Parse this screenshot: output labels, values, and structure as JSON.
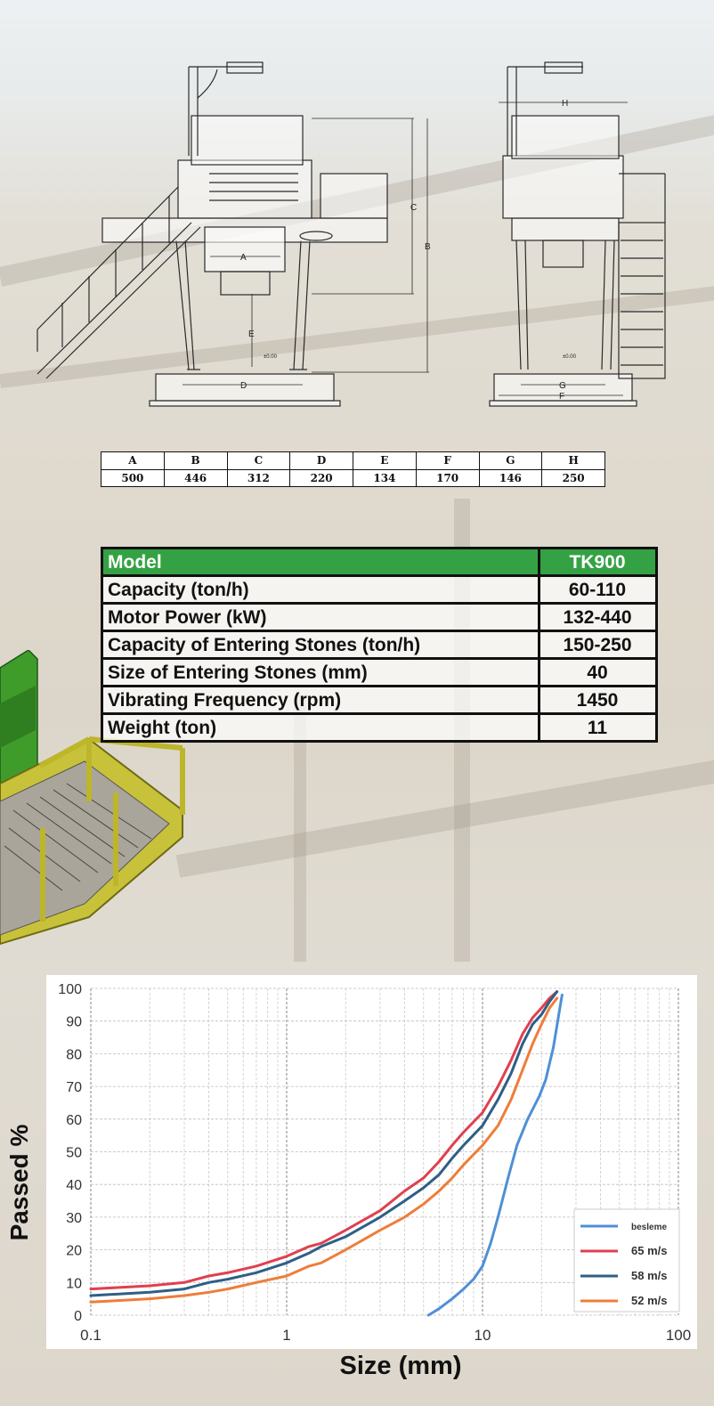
{
  "dimension_table": {
    "headers": [
      "A",
      "B",
      "C",
      "D",
      "E",
      "F",
      "G",
      "H"
    ],
    "values": [
      "500",
      "446",
      "312",
      "220",
      "134",
      "170",
      "146",
      "250"
    ]
  },
  "drawing_labels": {
    "front": [
      "A",
      "B",
      "C",
      "D",
      "E"
    ],
    "side": [
      "H",
      "G",
      "F"
    ],
    "level_mark": "±0.00"
  },
  "specs": {
    "header": {
      "label": "Model",
      "value": "TK900"
    },
    "rows": [
      {
        "label": "Capacity (ton/h)",
        "value": "60-110"
      },
      {
        "label": "Motor Power (kW)",
        "value": "132-440"
      },
      {
        "label": "Capacity of Entering Stones (ton/h)",
        "value": "150-250"
      },
      {
        "label": "Size of Entering Stones (mm)",
        "value": "40"
      },
      {
        "label": "Vibrating Frequency (rpm)",
        "value": "1450"
      },
      {
        "label": "Weight (ton)",
        "value": "11"
      }
    ],
    "header_color": "#34a244"
  },
  "chart_data": {
    "type": "line",
    "xscale": "log",
    "xlim": [
      0.1,
      100
    ],
    "ylim": [
      0,
      100
    ],
    "x_ticks": [
      "0.1",
      "1",
      "10",
      "100"
    ],
    "y_ticks": [
      "0",
      "10",
      "20",
      "30",
      "40",
      "50",
      "60",
      "70",
      "80",
      "90",
      "100"
    ],
    "xlabel": "Size (mm)",
    "ylabel": "Passed %",
    "grid": true,
    "legend_position": "bottom-right",
    "series": [
      {
        "name": "besleme",
        "color": "#4f8fd6",
        "points": [
          [
            5.3,
            0
          ],
          [
            6,
            2
          ],
          [
            7,
            5
          ],
          [
            8,
            8
          ],
          [
            9,
            11
          ],
          [
            10,
            15
          ],
          [
            11,
            22
          ],
          [
            12,
            30
          ],
          [
            13.5,
            42
          ],
          [
            15,
            52
          ],
          [
            17,
            60
          ],
          [
            19.5,
            67
          ],
          [
            21,
            72
          ],
          [
            23,
            82
          ],
          [
            25,
            95
          ],
          [
            25.5,
            98
          ]
        ]
      },
      {
        "name": "65 m/s",
        "color": "#e0404f",
        "points": [
          [
            0.1,
            8
          ],
          [
            0.2,
            9
          ],
          [
            0.3,
            10
          ],
          [
            0.4,
            12
          ],
          [
            0.5,
            13
          ],
          [
            0.7,
            15
          ],
          [
            1,
            18
          ],
          [
            1.3,
            21
          ],
          [
            1.5,
            22
          ],
          [
            2,
            26
          ],
          [
            3,
            32
          ],
          [
            4,
            38
          ],
          [
            5,
            42
          ],
          [
            6,
            47
          ],
          [
            7,
            52
          ],
          [
            8,
            56
          ],
          [
            10,
            62
          ],
          [
            12,
            70
          ],
          [
            14,
            78
          ],
          [
            16,
            86
          ],
          [
            18,
            91
          ],
          [
            20,
            94
          ],
          [
            22,
            97
          ],
          [
            24,
            99
          ]
        ]
      },
      {
        "name": "58 m/s",
        "color": "#2e5f86",
        "points": [
          [
            0.1,
            6
          ],
          [
            0.2,
            7
          ],
          [
            0.3,
            8
          ],
          [
            0.4,
            10
          ],
          [
            0.5,
            11
          ],
          [
            0.7,
            13
          ],
          [
            1,
            16
          ],
          [
            1.3,
            19
          ],
          [
            1.5,
            21
          ],
          [
            2,
            24
          ],
          [
            3,
            30
          ],
          [
            4,
            35
          ],
          [
            5,
            39
          ],
          [
            6,
            43
          ],
          [
            7,
            48
          ],
          [
            8,
            52
          ],
          [
            10,
            58
          ],
          [
            12,
            66
          ],
          [
            14,
            74
          ],
          [
            16,
            83
          ],
          [
            18,
            89
          ],
          [
            20,
            92
          ],
          [
            22,
            96
          ],
          [
            24,
            99
          ]
        ]
      },
      {
        "name": "52 m/s",
        "color": "#ee7d3a",
        "points": [
          [
            0.1,
            4
          ],
          [
            0.2,
            5
          ],
          [
            0.3,
            6
          ],
          [
            0.4,
            7
          ],
          [
            0.5,
            8
          ],
          [
            0.7,
            10
          ],
          [
            1,
            12
          ],
          [
            1.3,
            15
          ],
          [
            1.5,
            16
          ],
          [
            2,
            20
          ],
          [
            3,
            26
          ],
          [
            4,
            30
          ],
          [
            5,
            34
          ],
          [
            6,
            38
          ],
          [
            7,
            42
          ],
          [
            8,
            46
          ],
          [
            10,
            52
          ],
          [
            12,
            58
          ],
          [
            14,
            66
          ],
          [
            16,
            75
          ],
          [
            18,
            83
          ],
          [
            20,
            89
          ],
          [
            22,
            94
          ],
          [
            24,
            97
          ]
        ]
      }
    ]
  }
}
